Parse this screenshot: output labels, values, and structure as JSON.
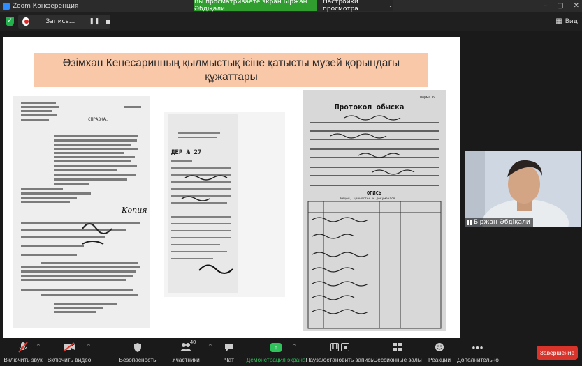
{
  "window": {
    "title": "Zoom Конференция",
    "share_banner": "Вы просматриваете экран Біржан Әбдіқали",
    "view_options": "Настройки просмотра",
    "view_button": "Вид"
  },
  "recording": {
    "label": "Запись..."
  },
  "slide": {
    "title_line1": "Әзімхан Кенесаринның қылмыстық ісіне қатысты музей қорындағы",
    "title_line2": "құжаттары",
    "doc1": {
      "header": "СПРАВКА.",
      "stamp": "Копия"
    },
    "doc2": {
      "header": "ДЕР № 27"
    },
    "doc3": {
      "header": "Протокол обыска",
      "corner": "Форма 6",
      "subheader": "ОПИСЬ",
      "subheader2": "Вещей, ценностей и документов"
    }
  },
  "participant": {
    "name": "Біржан Әбдіқали"
  },
  "toolbar": {
    "mute": "Включить звук",
    "video": "Включить видео",
    "security": "Безопасность",
    "participants": "Участники",
    "participants_count": "40",
    "chat": "Чат",
    "share": "Демонстрация экрана",
    "pause_record": "Пауза/остановить запись",
    "breakout": "Сессионные залы",
    "reactions": "Реакции",
    "more": "Дополнительно",
    "end": "Завершение"
  },
  "colors": {
    "share_green": "#2f9e2f",
    "title_fill": "#f9c8a8",
    "end_red": "#d9342b"
  }
}
